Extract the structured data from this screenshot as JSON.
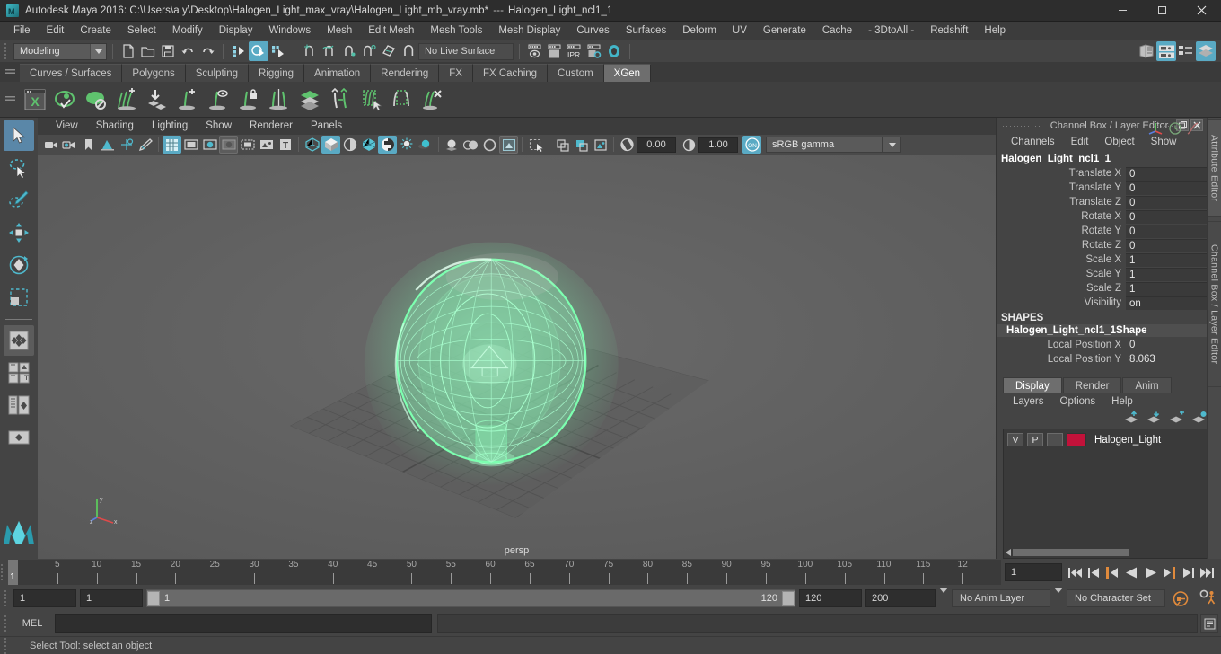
{
  "window": {
    "title": "Autodesk Maya 2016: C:\\Users\\a y\\Desktop\\Halogen_Light_max_vray\\Halogen_Light_mb_vray.mb*",
    "title_separator": "---",
    "title_object": "Halogen_Light_ncl1_1",
    "app_icon": "maya-logo-icon",
    "minimize": "minimize-icon",
    "maximize": "maximize-icon",
    "close": "close-icon"
  },
  "menubar": {
    "items": [
      "File",
      "Edit",
      "Create",
      "Select",
      "Modify",
      "Display",
      "Windows",
      "Mesh",
      "Edit Mesh",
      "Mesh Tools",
      "Mesh Display",
      "Curves",
      "Surfaces",
      "Deform",
      "UV",
      "Generate",
      "Cache",
      "- 3DtoAll -",
      "Redshift",
      "Help"
    ]
  },
  "statusline": {
    "menuset": "Modeling",
    "live_surface": "No Live Surface",
    "icons": [
      "new-scene-icon",
      "open-scene-icon",
      "save-scene-icon",
      "undo-icon",
      "redo-icon",
      "select-by-hierarchy-icon",
      "select-by-object-icon",
      "select-by-component-icon",
      "snap-to-grid-icon",
      "snap-to-curve-icon",
      "snap-to-point-icon",
      "snap-to-projected-center-icon",
      "snap-to-view-plane-icon",
      "magnet-icon",
      "render-current-frame-icon",
      "render-sequence-icon",
      "ipr-render-icon",
      "render-settings-icon",
      "hypershade-icon",
      "show-hide-editors-icon",
      "attribute-editor-toggle-icon",
      "tool-settings-toggle-icon",
      "channel-box-toggle-icon"
    ],
    "active_select_mode": "select-by-object-icon"
  },
  "shelf": {
    "tabs": [
      "Curves / Surfaces",
      "Polygons",
      "Sculpting",
      "Rigging",
      "Animation",
      "Rendering",
      "FX",
      "FX Caching",
      "Custom",
      "XGen"
    ],
    "active_tab": "XGen",
    "icons": [
      "xgen-window-icon",
      "xgen-preview-icon",
      "xgen-no-preview-icon",
      "xgen-add-density-icon",
      "xgen-place-icon",
      "xgen-add-guide-icon",
      "xgen-guide-visibility-icon",
      "xgen-lock-guide-icon",
      "xgen-mirror-guide-icon",
      "xgen-layers-icon",
      "xgen-move-guide-icon",
      "xgen-select-region-icon",
      "xgen-region-box-icon",
      "xgen-delete-guide-icon"
    ]
  },
  "toolbox": {
    "items": [
      "select-tool",
      "lasso-select-tool",
      "paint-select-tool",
      "move-tool",
      "rotate-tool",
      "scale-tool",
      "last-tool-used",
      "snap-layouts-icon",
      "four-view-layout-icon",
      "outliner-persp-layout-icon",
      "single-persp-layout-icon",
      "maya-logo-watermark-icon"
    ],
    "active": "select-tool"
  },
  "viewport": {
    "menus": [
      "View",
      "Shading",
      "Lighting",
      "Show",
      "Renderer",
      "Panels"
    ],
    "camera_label": "persp",
    "exposure": "0.00",
    "gamma": "1.00",
    "color_mgmt_toggle": "ON",
    "view_transform": "sRGB gamma",
    "toolbar_icons": [
      "select-camera-icon",
      "camera-attributes-icon",
      "bookmark-icon",
      "image-plane-icon",
      "two-d-pan-zoom-icon",
      "grease-pencil-icon",
      "grid-toggle-icon",
      "film-gate-icon",
      "resolution-gate-icon",
      "gate-mask-icon",
      "film-origin-icon",
      "exposure-icon",
      "safe-title-icon",
      "wireframe-shading-icon",
      "smooth-shade-all-icon",
      "shade-selected-items-icon",
      "wireframe-on-shaded-icon",
      "texture-toggle-icon",
      "lighting-toggle-icon",
      "shadow-toggle-icon",
      "screen-space-ao-icon",
      "motion-blur-icon",
      "multisample-aa-icon",
      "isolate-select-icon",
      "xray-icon",
      "xray-joints-icon",
      "xray-active-components-icon",
      "exposure-control-icon",
      "gamma-control-icon"
    ],
    "active_toolbar_icons": [
      "grid-toggle-icon",
      "smooth-shade-all-icon",
      "multisample-aa-icon",
      "color-management-toggle-icon"
    ],
    "model": {
      "name": "Halogen_Light_ncl1_1",
      "selection_color": "#7dffb0",
      "background_color": "#606060",
      "grid_color": "#4a4a4a"
    },
    "axis_gizmo": {
      "x": "x",
      "y": "y",
      "z": "z"
    }
  },
  "channel_box": {
    "panel_title": "Channel Box / Layer Editor",
    "menus": [
      "Channels",
      "Edit",
      "Object",
      "Show"
    ],
    "object_name": "Halogen_Light_ncl1_1",
    "attributes": [
      {
        "label": "Translate X",
        "value": "0"
      },
      {
        "label": "Translate Y",
        "value": "0"
      },
      {
        "label": "Translate Z",
        "value": "0"
      },
      {
        "label": "Rotate X",
        "value": "0"
      },
      {
        "label": "Rotate Y",
        "value": "0"
      },
      {
        "label": "Rotate Z",
        "value": "0"
      },
      {
        "label": "Scale X",
        "value": "1"
      },
      {
        "label": "Scale Y",
        "value": "1"
      },
      {
        "label": "Scale Z",
        "value": "1"
      },
      {
        "label": "Visibility",
        "value": "on"
      }
    ],
    "shapes_header": "SHAPES",
    "shape_name": "Halogen_Light_ncl1_1Shape",
    "shape_attributes": [
      {
        "label": "Local Position X",
        "value": "0"
      },
      {
        "label": "Local Position Y",
        "value": "8.063"
      }
    ],
    "dock_buttons": [
      "undock-icon",
      "close-panel-icon"
    ],
    "header_icons": [
      "axis-gizmo-icon",
      "clock-icon",
      "curve-icon"
    ]
  },
  "layer_editor": {
    "tabs": [
      "Display",
      "Render",
      "Anim"
    ],
    "active_tab": "Display",
    "menus": [
      "Layers",
      "Options",
      "Help"
    ],
    "buttons": [
      "move-layer-up-icon",
      "move-layer-down-icon",
      "new-layer-icon",
      "new-layer-from-selected-icon"
    ],
    "layers": [
      {
        "visibility": "V",
        "playback": "P",
        "shading": "",
        "color": "#c2123a",
        "name": "Halogen_Light"
      }
    ]
  },
  "attribute_editor_tab": {
    "labels": [
      "Attribute Editor",
      "Channel Box / Layer Editor"
    ]
  },
  "timeline": {
    "ticks": [
      "5",
      "10",
      "15",
      "20",
      "25",
      "30",
      "35",
      "40",
      "45",
      "50",
      "55",
      "60",
      "65",
      "70",
      "75",
      "80",
      "85",
      "90",
      "95",
      "100",
      "105",
      "110",
      "115",
      "12"
    ],
    "current_frame_marker": "1",
    "current_frame_field": "1",
    "playback_buttons": [
      "go-to-start-icon",
      "step-back-key-icon",
      "step-back-frame-icon",
      "play-backwards-icon",
      "play-forwards-icon",
      "step-forward-frame-icon",
      "step-forward-key-icon",
      "go-to-end-icon"
    ]
  },
  "range_slider": {
    "anim_start": "1",
    "playback_start": "1",
    "range_start_label": "1",
    "range_end_label": "120",
    "playback_end": "120",
    "anim_end": "200",
    "anim_layer": "No Anim Layer",
    "character_set": "No Character Set",
    "buttons": [
      "auto-key-icon",
      "animation-preferences-icon"
    ]
  },
  "command_line": {
    "language_label": "MEL",
    "input_value": "",
    "output_value": "",
    "script_editor_button": "script-editor-icon"
  },
  "help_line": {
    "text": "Select Tool: select an object"
  },
  "colors": {
    "accent": "#5aaac4",
    "selection_green": "#7dffb0",
    "layer_red": "#c2123a",
    "panel_bg": "#444444",
    "title_bg": "#2d2d2d",
    "orange": "#e08a3c"
  }
}
